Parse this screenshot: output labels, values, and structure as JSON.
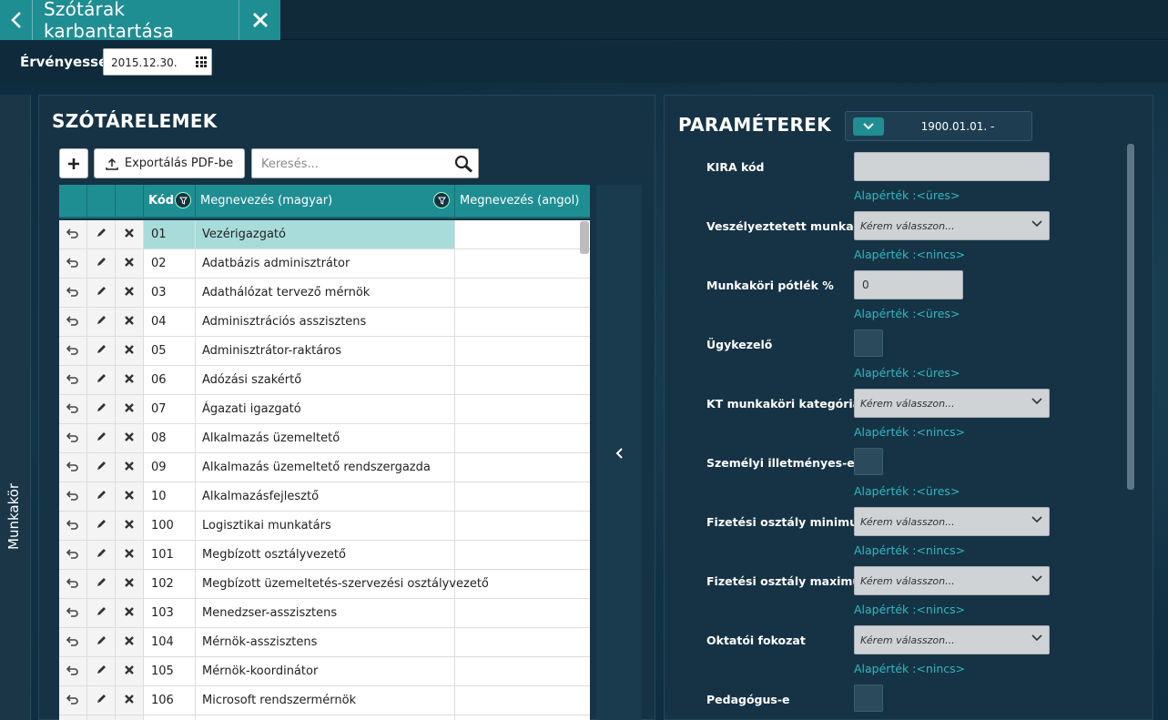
{
  "window": {
    "title": "Szótárak karbantartása"
  },
  "validity": {
    "label": "Érvényesség",
    "date": "2015.12.30."
  },
  "side_tab": {
    "label": "Munkakör"
  },
  "left_panel": {
    "title": "SZÓTÁRELEMEK",
    "export_label": "Exportálás PDF-be",
    "search_placeholder": "Keresés...",
    "columns": {
      "code": "Kód",
      "name_hu": "Megnevezés (magyar)",
      "name_en": "Megnevezés (angol)"
    },
    "rows": [
      {
        "code": "01",
        "name": "Vezérigazgató",
        "en": "",
        "selected": true
      },
      {
        "code": "02",
        "name": "Adatbázis adminisztrátor",
        "en": ""
      },
      {
        "code": "03",
        "name": "Adathálózat tervező mérnök",
        "en": ""
      },
      {
        "code": "04",
        "name": "Adminisztrációs asszisztens",
        "en": ""
      },
      {
        "code": "05",
        "name": "Adminisztrátor-raktáros",
        "en": ""
      },
      {
        "code": "06",
        "name": "Adózási szakértő",
        "en": ""
      },
      {
        "code": "07",
        "name": "Ágazati igazgató",
        "en": ""
      },
      {
        "code": "08",
        "name": "Alkalmazás üzemeltető",
        "en": ""
      },
      {
        "code": "09",
        "name": "Alkalmazás üzemeltető rendszergazda",
        "en": ""
      },
      {
        "code": "10",
        "name": "Alkalmazásfejlesztő",
        "en": ""
      },
      {
        "code": "100",
        "name": "Logisztikai munkatárs",
        "en": ""
      },
      {
        "code": "101",
        "name": "Megbízott osztályvezető",
        "en": ""
      },
      {
        "code": "102",
        "name": "Megbízott üzemeltetés-szervezési osztályvezető",
        "en": ""
      },
      {
        "code": "103",
        "name": "Menedzser-asszisztens",
        "en": ""
      },
      {
        "code": "104",
        "name": "Mérnök-asszisztens",
        "en": ""
      },
      {
        "code": "105",
        "name": "Mérnök-koordinátor",
        "en": ""
      },
      {
        "code": "106",
        "name": "Microsoft rendszermérnök",
        "en": ""
      },
      {
        "code": "",
        "name": "",
        "en": ""
      }
    ]
  },
  "right_panel": {
    "title": "PARAMÉTEREK",
    "version_value": "1900.01.01. -",
    "params": {
      "kira": {
        "label": "KIRA kód",
        "value": "",
        "default": "Alapérték :<üres>"
      },
      "hazard": {
        "label": "Veszélyeztetett munkakör",
        "value": "Kérem válasszon...",
        "default": "Alapérték :<nincs>"
      },
      "allowance": {
        "label": "Munkaköri pótlék %",
        "value": "0",
        "default": "Alapérték :<üres>"
      },
      "clerk": {
        "label": "Ügykezelő",
        "default": "Alapérték :<üres>"
      },
      "kt": {
        "label": "KT munkaköri kategória",
        "value": "Kérem válasszon...",
        "default": "Alapérték :<nincs>"
      },
      "personal": {
        "label": "Személyi illetményes-e",
        "default": "Alapérték :<üres>"
      },
      "paymin": {
        "label": "Fizetési osztály minimum",
        "value": "Kérem válasszon...",
        "default": "Alapérték :<nincs>"
      },
      "paymax": {
        "label": "Fizetési osztály maximum",
        "value": "Kérem válasszon...",
        "default": "Alapérték :<nincs>"
      },
      "teacher": {
        "label": "Oktatói fokozat",
        "value": "Kérem válasszon...",
        "default": "Alapérték :<nincs>"
      },
      "pedagogue": {
        "label": "Pedagógus-e"
      }
    }
  },
  "colors": {
    "accent": "#1f8e93",
    "panel": "#163345",
    "default_text": "#2fb8c0"
  }
}
